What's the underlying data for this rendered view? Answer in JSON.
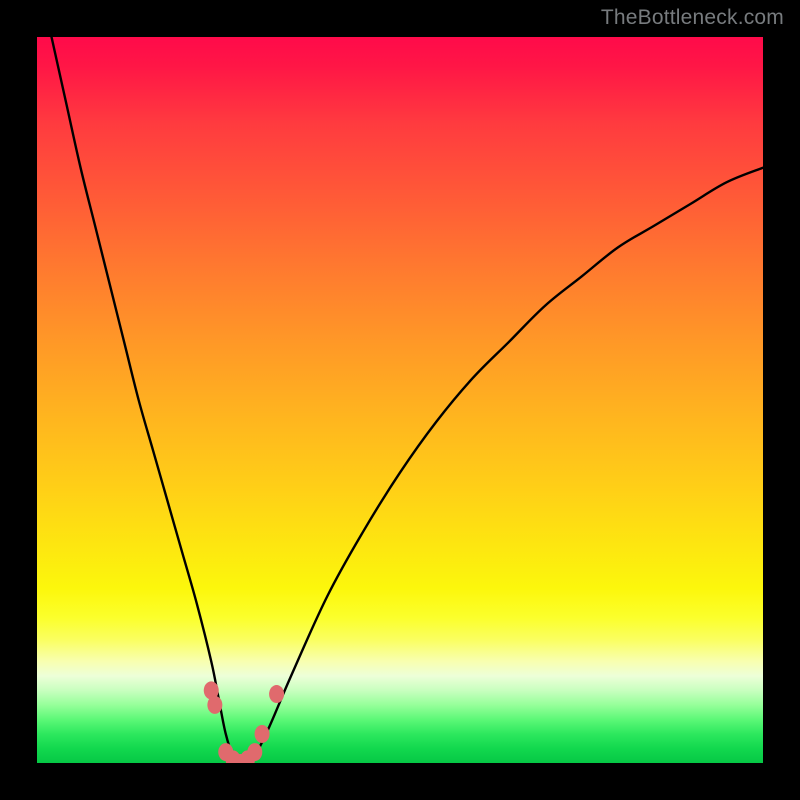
{
  "watermark": "TheBottleneck.com",
  "colors": {
    "frame": "#000000",
    "curve": "#000000",
    "marker": "#e06a6d"
  },
  "chart_data": {
    "type": "line",
    "title": "",
    "xlabel": "",
    "ylabel": "",
    "xlim": [
      0,
      100
    ],
    "ylim": [
      0,
      100
    ],
    "grid": false,
    "series": [
      {
        "name": "bottleneck-curve",
        "x": [
          2,
          4,
          6,
          8,
          10,
          12,
          14,
          16,
          18,
          20,
          22,
          24,
          25,
          26,
          27,
          28,
          29,
          30,
          32,
          35,
          40,
          45,
          50,
          55,
          60,
          65,
          70,
          75,
          80,
          85,
          90,
          95,
          100
        ],
        "y": [
          100,
          91,
          82,
          74,
          66,
          58,
          50,
          43,
          36,
          29,
          22,
          14,
          9,
          4,
          1,
          0,
          0,
          1,
          5,
          12,
          23,
          32,
          40,
          47,
          53,
          58,
          63,
          67,
          71,
          74,
          77,
          80,
          82
        ]
      }
    ],
    "markers": {
      "name": "highlight-points",
      "points": [
        {
          "x": 24.0,
          "y": 10.0
        },
        {
          "x": 24.5,
          "y": 8.0
        },
        {
          "x": 26.0,
          "y": 1.5
        },
        {
          "x": 27.0,
          "y": 0.5
        },
        {
          "x": 28.0,
          "y": 0.0
        },
        {
          "x": 29.0,
          "y": 0.5
        },
        {
          "x": 30.0,
          "y": 1.5
        },
        {
          "x": 31.0,
          "y": 4.0
        },
        {
          "x": 33.0,
          "y": 9.5
        }
      ]
    }
  }
}
